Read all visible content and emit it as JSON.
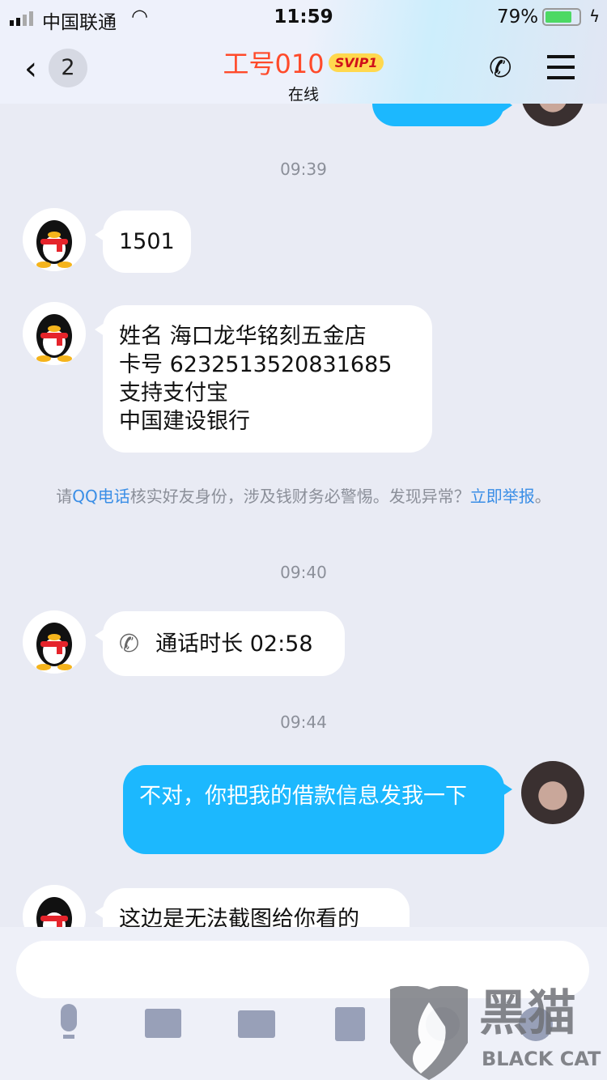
{
  "status": {
    "carrier": "中国联通",
    "time": "11:59",
    "battery": "79%"
  },
  "header": {
    "back_count": "2",
    "title": "工号010",
    "badge": "SVIP1",
    "subtitle": "在线"
  },
  "messages": [
    {
      "type": "time",
      "text": "09:39"
    },
    {
      "from": "contact",
      "text": "1501"
    },
    {
      "from": "contact",
      "lines": [
        "姓名 海口龙华铭刻五金店",
        "卡号 6232513520831685",
        "支持支付宝",
        "中国建设银行"
      ]
    },
    {
      "type": "notice",
      "pre": "请",
      "link1": "QQ电话",
      "mid": "核实好友身份，涉及钱财务必警惕。发现异常？",
      "link2": "立即举报",
      "post": "。"
    },
    {
      "type": "time",
      "text": "09:40"
    },
    {
      "from": "contact",
      "call": "通话时长 02:58"
    },
    {
      "type": "time",
      "text": "09:44"
    },
    {
      "from": "me",
      "text": "不对，你把我的借款信息发我一下"
    },
    {
      "from": "contact",
      "text": "这边是无法截图给你看的"
    }
  ],
  "toolbar": [
    "microphone-icon",
    "image-icon",
    "camera-icon",
    "red-packet-icon",
    "emoji-icon",
    "plus-icon"
  ],
  "watermark": {
    "text": "黑猫",
    "sub": "BLACK CAT"
  },
  "colors": {
    "title": "#ff4a2a",
    "bubble_me": "#1cb8fe",
    "link": "#3a8ee6",
    "badge": "#ffd84e"
  }
}
